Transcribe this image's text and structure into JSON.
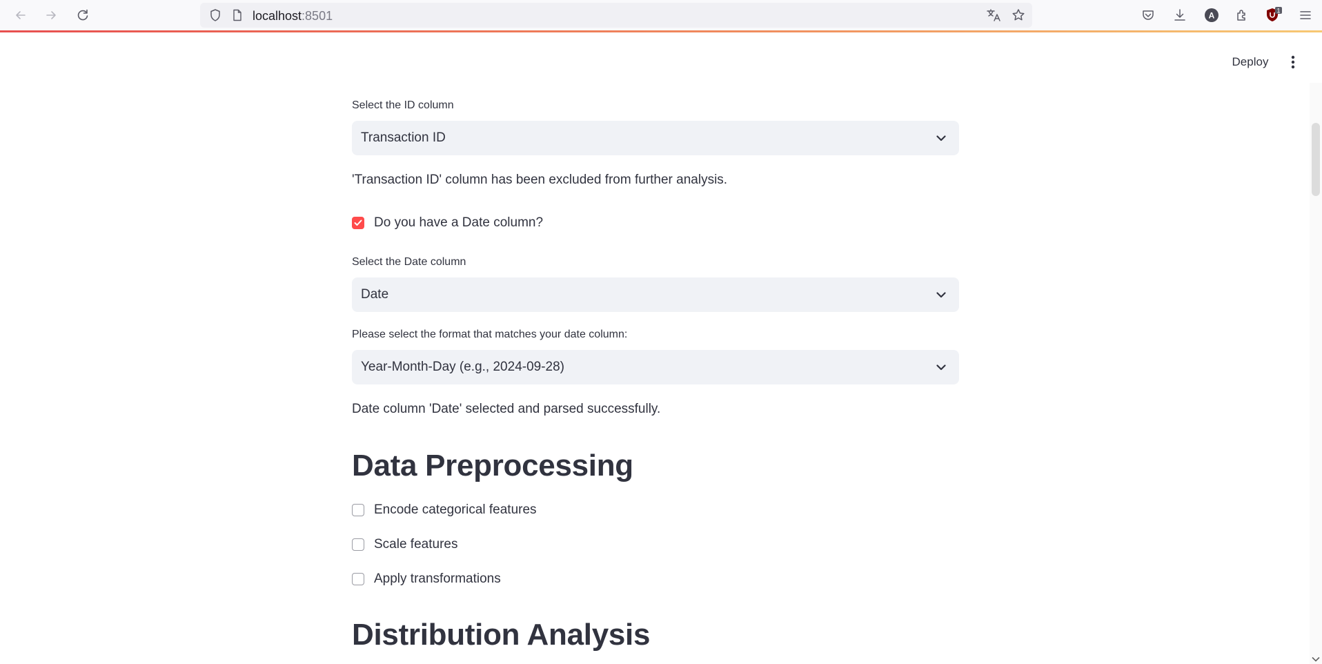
{
  "browser": {
    "url_host": "localhost",
    "url_port": ":8501",
    "extension_badge": "1"
  },
  "header": {
    "deploy_label": "Deploy"
  },
  "main": {
    "id_select": {
      "label": "Select the ID column",
      "value": "Transaction ID"
    },
    "id_info": "'Transaction ID' column has been excluded from further analysis.",
    "date_checkbox": {
      "label": "Do you have a Date column?",
      "checked": true
    },
    "date_select": {
      "label": "Select the Date column",
      "value": "Date"
    },
    "format_select": {
      "label": "Please select the format that matches your date column:",
      "value": "Year-Month-Day (e.g., 2024-09-28)"
    },
    "date_info": "Date column 'Date' selected and parsed successfully.",
    "preprocessing": {
      "heading": "Data Preprocessing",
      "options": [
        {
          "label": "Encode categorical features",
          "checked": false
        },
        {
          "label": "Scale features",
          "checked": false
        },
        {
          "label": "Apply transformations",
          "checked": false
        }
      ]
    },
    "distribution_heading": "Distribution Analysis"
  },
  "colors": {
    "accent": "#ff4b4b",
    "input_bg": "#f0f2f6",
    "text": "#31333f"
  }
}
